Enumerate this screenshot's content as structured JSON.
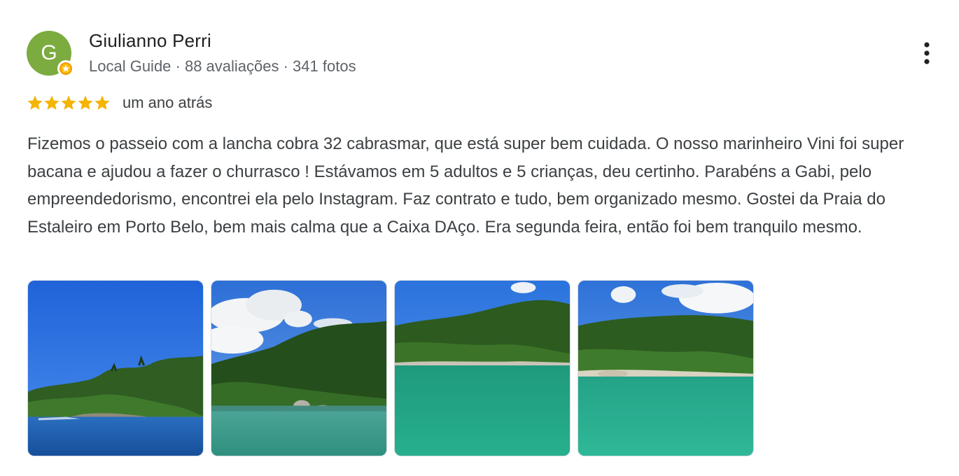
{
  "author": {
    "initial": "G",
    "name": "Giulianno Perri",
    "meta": "Local Guide · 88 avaliações · 341 fotos",
    "avatar_color": "#7cab3f"
  },
  "rating": {
    "stars": 5,
    "date": "um ano atrás",
    "star_color": "#f4b400"
  },
  "review": {
    "text": "Fizemos o passeio com a lancha cobra 32 cabrasmar, que está super bem cuidada. O nosso marinheiro Vini foi super bacana e ajudou a fazer o churrasco ! Estávamos em 5 adultos e 5 crianças, deu certinho. Parabéns a Gabi, pelo empreendedorismo, encontrei ela pelo Instagram. Faz contrato e tudo, bem organizado mesmo. Gostei da Praia do Estaleiro em Porto Belo, bem mais calma que a Caixa DAço. Era segunda feira, então foi bem tranquilo mesmo."
  },
  "photos": [
    {
      "subject": "island-with-blue-sea"
    },
    {
      "subject": "wooded-shore-with-clouds"
    },
    {
      "subject": "green-hill-turquoise-water"
    },
    {
      "subject": "beach-cove-turquoise-water"
    }
  ],
  "icons": {
    "more": "more-vert-icon",
    "badge": "local-guide-badge-icon",
    "star": "star-icon"
  }
}
